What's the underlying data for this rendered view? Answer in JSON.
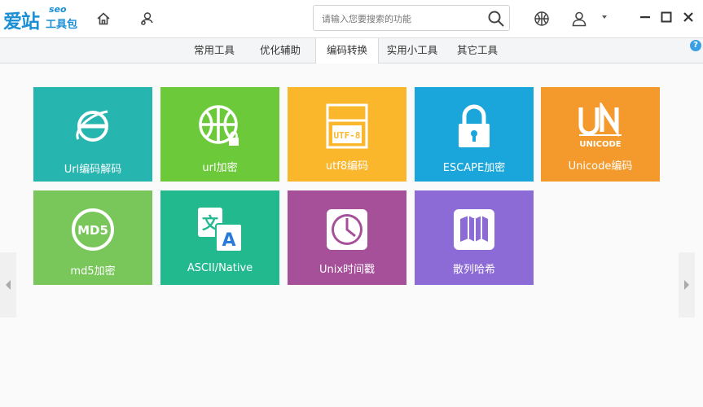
{
  "app": {
    "logo_main": "爱站",
    "logo_seo": "seo",
    "logo_sub": "工具包"
  },
  "search": {
    "placeholder": "请输入您要搜索的功能"
  },
  "tabs": [
    {
      "label": "常用工具"
    },
    {
      "label": "优化辅助"
    },
    {
      "label": "编码转换",
      "active": true
    },
    {
      "label": "实用小工具"
    },
    {
      "label": "其它工具"
    }
  ],
  "help_label": "?",
  "tiles": [
    {
      "label": "Url编码解码",
      "color": "#27b5b0",
      "icon": "ie-icon"
    },
    {
      "label": "url加密",
      "color": "#6cc93a",
      "icon": "globe-lock-icon"
    },
    {
      "label": "utf8编码",
      "color": "#fbb72c",
      "icon": "utf8-icon",
      "icon_text": "UTF-8"
    },
    {
      "label": "ESCAPE加密",
      "color": "#1ba6db",
      "icon": "padlock-icon"
    },
    {
      "label": "Unicode编码",
      "color": "#f49a2c",
      "icon": "unicode-icon",
      "icon_text": "UNICODE"
    },
    {
      "label": "md5加密",
      "color": "#79c65a",
      "icon": "md5-icon",
      "icon_text": "MD5"
    },
    {
      "label": "ASCII/Native",
      "color": "#23b98f",
      "icon": "translate-icon"
    },
    {
      "label": "Unix时间戳",
      "color": "#a6509a",
      "icon": "clock-icon"
    },
    {
      "label": "散列哈希",
      "color": "#8c6bd6",
      "icon": "map-icon"
    }
  ]
}
